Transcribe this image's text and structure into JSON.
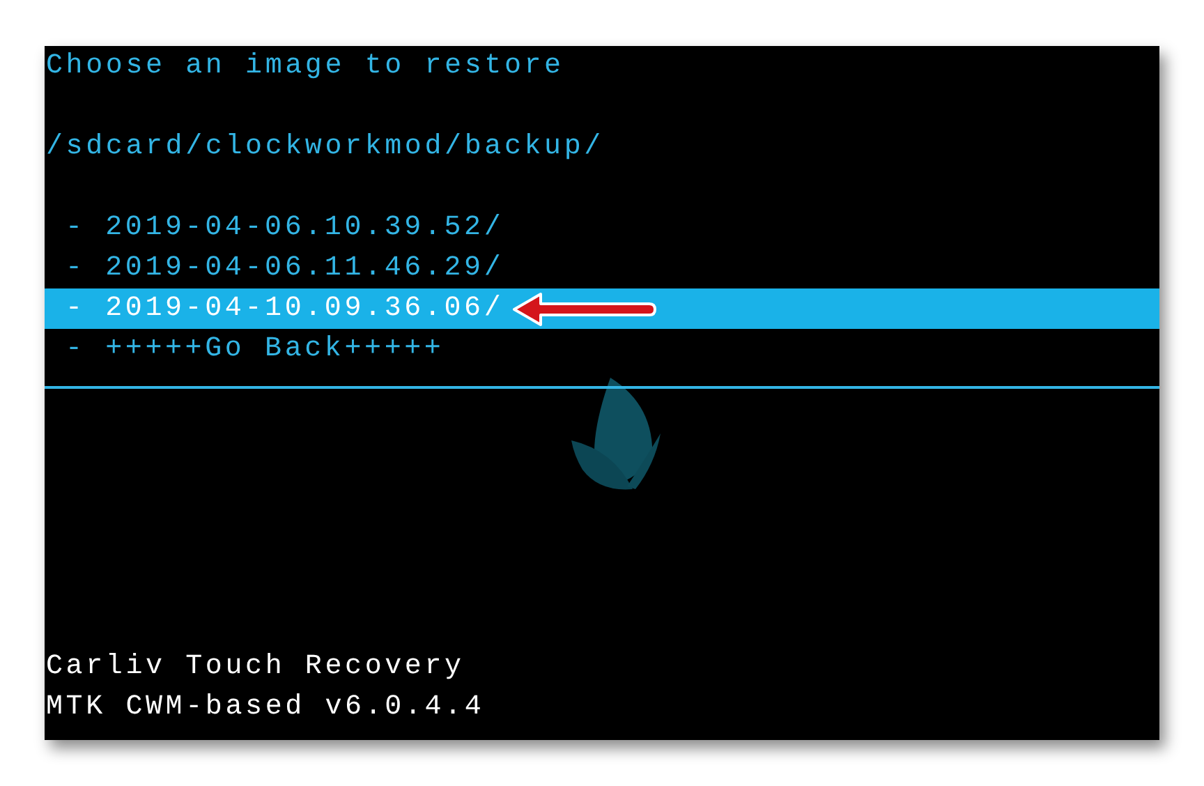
{
  "screen": {
    "title": "Choose an image to restore",
    "path": "/sdcard/clockworkmod/backup/",
    "items": [
      {
        "label": "- 2019-04-06.10.39.52/",
        "selected": false,
        "arrow": false
      },
      {
        "label": "- 2019-04-06.11.46.29/",
        "selected": false,
        "arrow": false
      },
      {
        "label": "- 2019-04-10.09.36.06/",
        "selected": true,
        "arrow": true
      },
      {
        "label": "- +++++Go Back+++++",
        "selected": false,
        "arrow": false
      }
    ],
    "footer": [
      "Carliv Touch Recovery",
      "MTK CWM-based v6.0.4.4"
    ]
  }
}
